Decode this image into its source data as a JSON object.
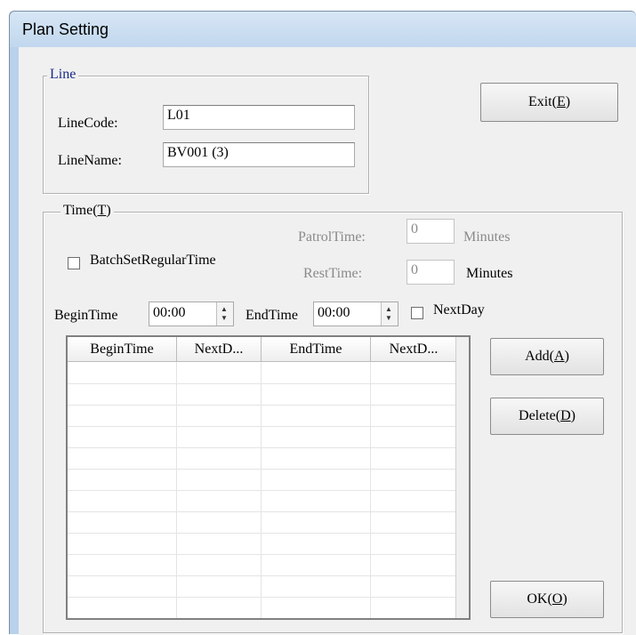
{
  "window": {
    "title": "Plan Setting"
  },
  "line_group": {
    "legend": "Line",
    "line_code_label": "LineCode:",
    "line_code_value": "L01",
    "line_name_label": "LineName:",
    "line_name_value": "BV001 (3)"
  },
  "exit_button": {
    "label": "Exit(",
    "mnemonic": "E",
    "suffix": ")"
  },
  "time_group": {
    "legend_prefix": "Time(",
    "legend_mnemonic": "T",
    "legend_suffix": ")",
    "batch_label": "BatchSetRegularTime",
    "batch_checked": false,
    "patrol_label": "PatrolTime:",
    "patrol_value": "0",
    "patrol_unit": "Minutes",
    "rest_label": "RestTime:",
    "rest_value": "0",
    "rest_unit": "Minutes",
    "begin_label": "BeginTime",
    "begin_value": "00:00",
    "end_label": "EndTime",
    "end_value": "00:00",
    "nextday_label": "NextDay",
    "nextday_checked": false
  },
  "table": {
    "columns": [
      "BeginTime",
      "NextD...",
      "EndTime",
      "NextD..."
    ],
    "rows": []
  },
  "buttons": {
    "add": {
      "label": "Add(",
      "mnemonic": "A",
      "suffix": ")"
    },
    "delete": {
      "label": "Delete(",
      "mnemonic": "D",
      "suffix": ")"
    },
    "ok": {
      "label": "OK(",
      "mnemonic": "O",
      "suffix": ")"
    }
  },
  "colors": {
    "titlebar": "#c9ddf2",
    "client": "#f0f0f0",
    "disabled_text": "#8a8a8a"
  }
}
